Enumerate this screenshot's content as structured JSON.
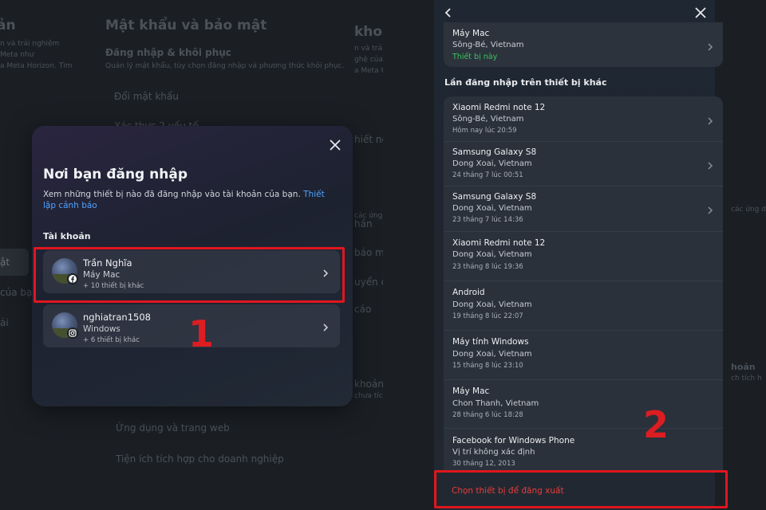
{
  "left": {
    "background": {
      "heading": "Mật khẩu và bảo mật",
      "subheading": "Đăng nhập & khôi phục",
      "subdesc": "Quản lý mật khẩu, tùy chọn đăng nhập và phương thức khôi phục.",
      "row1": "Đổi mật khẩu",
      "row_partial": "Xác thực 2 yếu tố",
      "left_edge": [
        "ản",
        "n và trải nghiệm",
        "Meta như",
        "a Meta Horizon. Tìm"
      ],
      "side_item": "ật",
      "side_item2": "của bạn",
      "side_item3": "ải",
      "bottom1": "Ứng dụng và trang web",
      "bottom2": "Tiện ích tích hợp cho doanh nghiệp",
      "behind_modal": "khoản",
      "behind_modal2": "ên",
      "peek_right": [
        "khoản",
        "n và trải nghiệm",
        "ghệ của Meta",
        "a Meta Horizon",
        "hiết nối",
        "các ứng d",
        "hần",
        "bảo mật",
        "uyển của bạn",
        "cáo",
        "khoản",
        "chưa tích h"
      ]
    },
    "modal": {
      "title": "Nơi bạn đăng nhập",
      "description": "Xem những thiết bị nào đã đăng nhập vào tài khoản của bạn.",
      "link": "Thiết lập cảnh báo",
      "section": "Tài khoản",
      "accounts": [
        {
          "name": "Trần Nghĩa",
          "device": "Máy Mac",
          "more": "+ 10 thiết bị khác",
          "platform": "facebook-icon"
        },
        {
          "name": "nghiatran1508",
          "device": "Windows",
          "more": "+ 6 thiết bị khác",
          "platform": "instagram-icon"
        }
      ]
    },
    "annotation": "1"
  },
  "right": {
    "current_device": {
      "name": "Máy Mac",
      "location": "Sông-Bé, Vietnam",
      "status": "Thiết bị này"
    },
    "section": "Lần đăng nhập trên thiết bị khác",
    "devices": [
      {
        "name": "Xiaomi Redmi note 12",
        "location": "Sông-Bé, Vietnam",
        "time": "Hôm nay lúc 20:59"
      },
      {
        "name": "Samsung Galaxy S8",
        "location": "Dong Xoai, Vietnam",
        "time": "24 tháng 7 lúc 00:51"
      },
      {
        "name": "Samsung Galaxy S8",
        "location": "Dong Xoai, Vietnam",
        "time": "23 tháng 7 lúc 14:36"
      },
      {
        "name": "Xiaomi Redmi note 12",
        "location": "Dong Xoai, Vietnam",
        "time": "23 tháng 8 lúc 19:36"
      },
      {
        "name": "Android",
        "location": "Dong Xoai, Vietnam",
        "time": "19 tháng 8 lúc 22:07"
      },
      {
        "name": "Máy tính Windows",
        "location": "Dong Xoai, Vietnam",
        "time": "15 tháng 8 lúc 23:10"
      },
      {
        "name": "Máy Mac",
        "location": "Chon Thanh, Vietnam",
        "time": "28 tháng 6 lúc 18:28"
      },
      {
        "name": "Facebook for Windows Phone",
        "location": "Vị trí không xác định",
        "time": "30 tháng 12, 2013"
      }
    ],
    "signout_label": "Chọn thiết bị để đăng xuất",
    "bg_right_edge": [
      "hoản",
      "ch tích h",
      "các ứng dụ"
    ],
    "annotation": "2"
  },
  "colors": {
    "highlight": "#e0161f",
    "link": "#4ea3ff",
    "this_device": "#3bc45a",
    "signout": "#ec3c3c"
  }
}
